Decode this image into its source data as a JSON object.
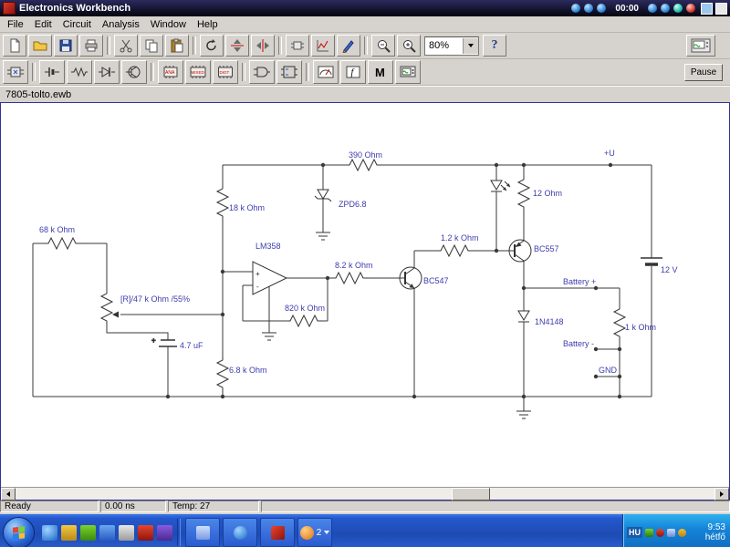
{
  "titlebar": {
    "title": "Electronics Workbench",
    "recorder_time": "00:00"
  },
  "menubar": {
    "items": [
      "File",
      "Edit",
      "Circuit",
      "Analysis",
      "Window",
      "Help"
    ]
  },
  "toolbar": {
    "zoom_value": "80%",
    "help_label": "?",
    "pause_label": "Pause",
    "bins": {
      "ana": "ANA",
      "mixed": "MIXED",
      "digt": "DIGT",
      "controls": "f",
      "misc": "M"
    }
  },
  "document": {
    "title": "7805-tolto.ewb"
  },
  "circuit": {
    "labels": {
      "r390": "390 Ohm",
      "plus_u": "+U",
      "r18k": "18 k Ohm",
      "zener": "ZPD6.8",
      "r12": "12 Ohm",
      "q2": "BC557",
      "r68k": "68 k Ohm",
      "opamp": "LM358",
      "r8k2": "8.2 k Ohm",
      "q1": "BC547",
      "r1k2": "1.2 k Ohm",
      "pot": "[R]/47 k Ohm /55%",
      "r820k": "820 k Ohm",
      "cap": "4.7 uF",
      "r6k8": "6.8 k Ohm",
      "d1": "1N4148",
      "batt_plus": "Battery +",
      "batt_minus": "Battery -",
      "r1k": "1 k Ohm",
      "gnd": "GND",
      "v1": "12 V",
      "plus": "+",
      "minus": "-"
    }
  },
  "statusbar": {
    "ready": "Ready",
    "sim_time": "0.00 ns",
    "temperature": "Temp: 27"
  },
  "taskbar": {
    "group_count": "2",
    "tray": {
      "lang": "HU",
      "clock": "9:53",
      "day": "hétfő"
    }
  }
}
